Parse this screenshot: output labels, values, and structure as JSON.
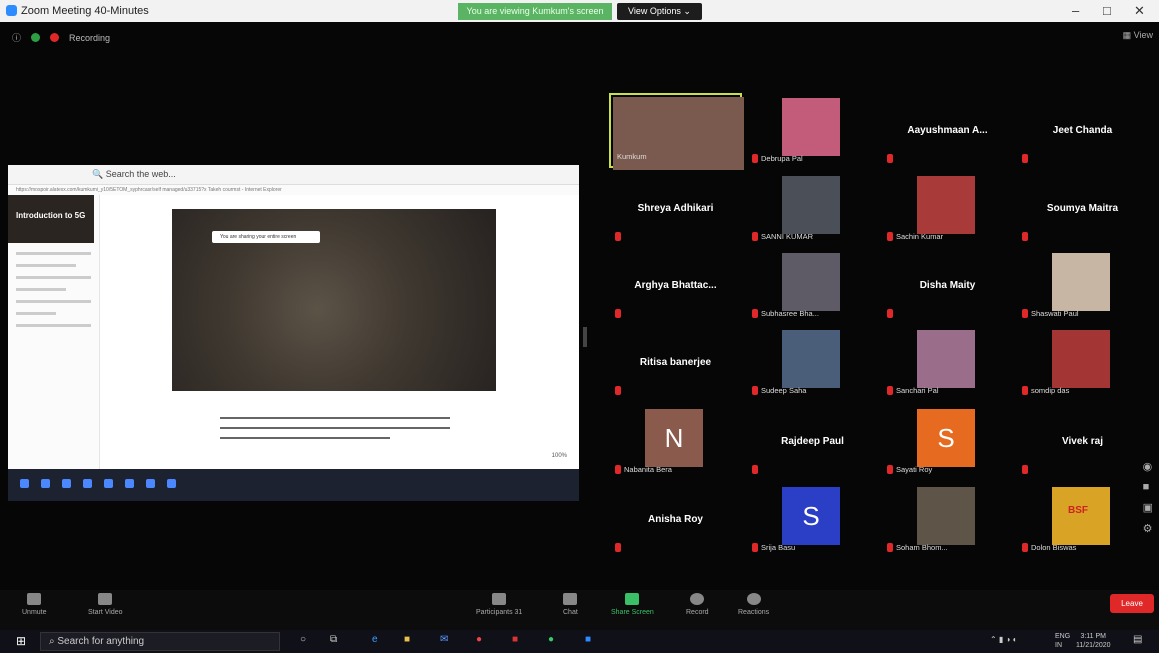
{
  "window": {
    "title": "Zoom Meeting 40-Minutes",
    "share_banner": "You are viewing Kumkum's screen",
    "view_options": "View Options",
    "minimize": "–",
    "restore": "□",
    "close": "✕"
  },
  "meeting": {
    "recording_label": "Recording",
    "view_label": "View"
  },
  "shared": {
    "search_text": "Search the web...",
    "url": "https://mospoir.alatexx.com/kumkumi_y10/5ETOM_syphrcasr/self managed/u33715?x Takeh courmst - Internet Explorer",
    "side_title": "Introduction to 5G",
    "pill_text": "You are sharing your entire screen",
    "zoom": "100%"
  },
  "participants": [
    {
      "name": "Kumkum",
      "kind": "video",
      "col": 0,
      "row": 0,
      "color": "#7a5a4f",
      "selected": true
    },
    {
      "name": "Debrupa Pal",
      "kind": "video",
      "col": 1,
      "row": 0,
      "color": "#c25c7a"
    },
    {
      "name": "Aayushmaan  A...",
      "kind": "name",
      "col": 2,
      "row": 0
    },
    {
      "name": "Jeet Chanda",
      "kind": "name",
      "col": 3,
      "row": 0
    },
    {
      "name": "Shreya Adhikari",
      "kind": "name",
      "col": 0,
      "row": 1
    },
    {
      "name": "SANNI KUMAR",
      "kind": "video",
      "col": 1,
      "row": 1,
      "color": "#4b4f58"
    },
    {
      "name": "Sachin Kumar",
      "kind": "video",
      "col": 2,
      "row": 1,
      "color": "#a83a3a"
    },
    {
      "name": "Soumya Maitra",
      "kind": "name",
      "col": 3,
      "row": 1
    },
    {
      "name": "Arghya  Bhattac...",
      "kind": "name",
      "col": 0,
      "row": 2
    },
    {
      "name": "Subhasree Bha...",
      "kind": "video",
      "col": 1,
      "row": 2,
      "color": "#5e5a66"
    },
    {
      "name": "Disha Maity",
      "kind": "name",
      "col": 2,
      "row": 2
    },
    {
      "name": "Shaswati Paul",
      "kind": "video",
      "col": 3,
      "row": 2,
      "color": "#c8b6a5"
    },
    {
      "name": "Ritisa banerjee",
      "kind": "name",
      "col": 0,
      "row": 3
    },
    {
      "name": "Sudeep Saha",
      "kind": "video",
      "col": 1,
      "row": 3,
      "color": "#4a5e7a"
    },
    {
      "name": "Sanchari Pal",
      "kind": "video",
      "col": 2,
      "row": 3,
      "color": "#9a6e8a"
    },
    {
      "name": "somdip das",
      "kind": "video",
      "col": 3,
      "row": 3,
      "color": "#a33535"
    },
    {
      "name": "Nabanita Bera",
      "kind": "letter",
      "letter": "N",
      "col": 0,
      "row": 4,
      "color": "#8a5a4d"
    },
    {
      "name": "Rajdeep Paul",
      "kind": "name",
      "col": 1,
      "row": 4
    },
    {
      "name": "Sayati Roy",
      "kind": "letter",
      "letter": "S",
      "col": 2,
      "row": 4,
      "color": "#e66a1f"
    },
    {
      "name": "Vivek raj",
      "kind": "name",
      "col": 3,
      "row": 4
    },
    {
      "name": "Anisha Roy",
      "kind": "name",
      "col": 0,
      "row": 5
    },
    {
      "name": "Srija Basu",
      "kind": "letter",
      "letter": "S",
      "col": 1,
      "row": 5,
      "color": "#2b3fc6"
    },
    {
      "name": "Soham Bhom...",
      "kind": "video",
      "col": 2,
      "row": 5,
      "color": "#5e5448"
    },
    {
      "name": "Dolon Biswas",
      "kind": "video",
      "col": 3,
      "row": 5,
      "color": "#d9a425",
      "badge": "BSF"
    }
  ],
  "toolbar": {
    "unmute": "Unmute",
    "start_video": "Start Video",
    "participants": "Participants",
    "participants_count": "31",
    "chat": "Chat",
    "share_screen": "Share Screen",
    "record": "Record",
    "reactions": "Reactions",
    "leave": "Leave"
  },
  "taskbar": {
    "search_placeholder": "Search for anything",
    "lang": "ENG",
    "region": "IN",
    "time": "3:11 PM",
    "date": "11/21/2020"
  }
}
